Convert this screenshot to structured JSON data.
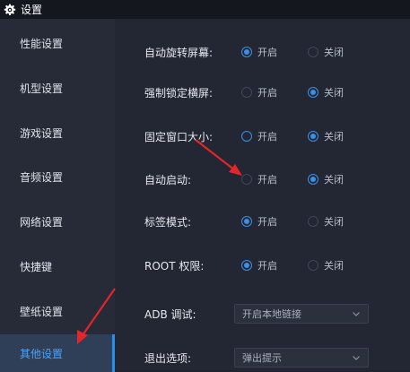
{
  "window": {
    "title": "设置"
  },
  "sidebar": {
    "items": [
      {
        "label": "性能设置"
      },
      {
        "label": "机型设置"
      },
      {
        "label": "游戏设置"
      },
      {
        "label": "音频设置"
      },
      {
        "label": "网络设置"
      },
      {
        "label": "快捷键"
      },
      {
        "label": "壁纸设置"
      },
      {
        "label": "其他设置"
      }
    ],
    "active_index": 7
  },
  "settings": {
    "auto_rotate": {
      "label": "自动旋转屏幕:",
      "on_label": "开启",
      "off_label": "关闭",
      "value": "on"
    },
    "force_landscape": {
      "label": "强制锁定横屏:",
      "on_label": "开启",
      "off_label": "关闭",
      "value": "off"
    },
    "fixed_window": {
      "label": "固定窗口大小:",
      "on_label": "开启",
      "off_label": "关闭",
      "value": "off"
    },
    "auto_start": {
      "label": "自动启动:",
      "on_label": "开启",
      "off_label": "关闭",
      "value": "off"
    },
    "tab_mode": {
      "label": "标签模式:",
      "on_label": "开启",
      "off_label": "关闭",
      "value": "on"
    },
    "root": {
      "label": "ROOT 权限:",
      "on_label": "开启",
      "off_label": "关闭",
      "value": "on"
    },
    "adb": {
      "label": "ADB 调试:",
      "selected": "开启本地链接"
    },
    "exit": {
      "label": "退出选项:",
      "selected": "弹出提示"
    }
  },
  "colors": {
    "accent": "#3d8fe6",
    "annotation": "#e2262a"
  }
}
